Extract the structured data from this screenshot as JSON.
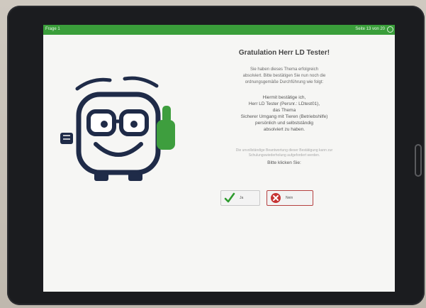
{
  "topbar": {
    "left_text": "Frage 1",
    "right_text": "Seite 13 von 20"
  },
  "main": {
    "title": "Gratulation Herr LD Tester!",
    "paragraph1": [
      "Sie haben dieses Thema erfolgreich",
      "absolviert. Bitte bestätigen Sie nun noch die",
      "ordnungsgemäße Durchführung wie folgt:"
    ],
    "paragraph2": [
      "Hiermit bestätige ich,",
      "Herr LD Tester (Persnr.: LDtest01),",
      "das Thema",
      "Sicherer Umgang mit Tieren (Betriebshilfe)",
      "persönlich und selbstständig",
      "absolviert zu haben."
    ],
    "paragraph3": [
      "Die unvollständige Beantwortung dieser Bestätigung kann zur",
      "Schulungswiederholung aufgefordert werden."
    ],
    "paragraph4": "Bitte klicken Sie:"
  },
  "buttons": {
    "yes_label": "Ja",
    "no_label": "Nein"
  },
  "colors": {
    "accent": "#3a9e3a",
    "mascot_outline": "#1f2b48",
    "confirm_green": "#2e9b2e",
    "cancel_red": "#c73434"
  },
  "icons": {
    "close": "close-circle-icon",
    "yes": "checkmark-icon",
    "no": "x-circle-icon"
  }
}
